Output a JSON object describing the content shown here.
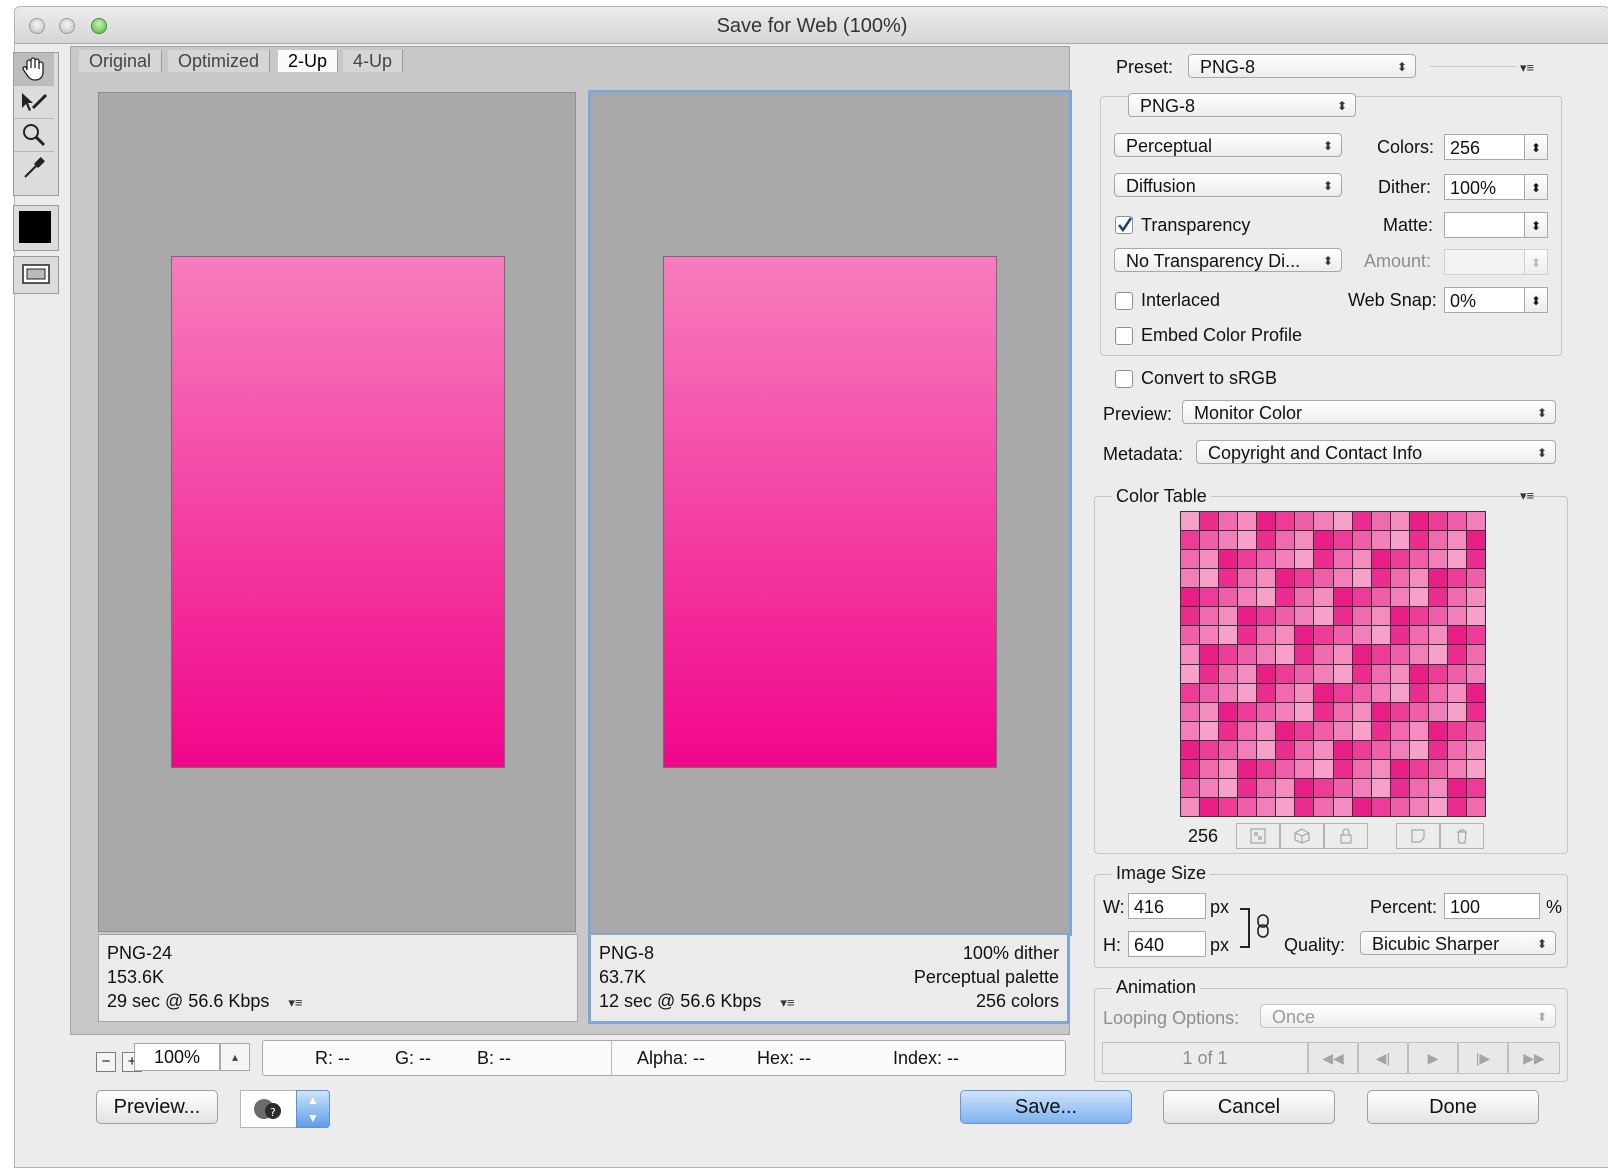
{
  "window": {
    "title": "Save for Web (100%)"
  },
  "tools": [
    "hand-tool",
    "slice-select-tool",
    "zoom-tool",
    "eyedropper-tool"
  ],
  "tabs": [
    {
      "label": "Original"
    },
    {
      "label": "Optimized"
    },
    {
      "label": "2-Up",
      "active": true
    },
    {
      "label": "4-Up"
    }
  ],
  "left_pane": {
    "format": "PNG-24",
    "size": "153.6K",
    "time": "29 sec @ 56.6 Kbps"
  },
  "right_pane": {
    "format": "PNG-8",
    "size": "63.7K",
    "time": "12 sec @ 56.6 Kbps",
    "dither": "100% dither",
    "palette": "Perceptual palette",
    "colors": "256 colors"
  },
  "statusbar": {
    "zoom": "100%",
    "r": "R: --",
    "g": "G: --",
    "b": "B: --",
    "alpha": "Alpha: --",
    "hex": "Hex: --",
    "index": "Index: --"
  },
  "buttons": {
    "preview": "Preview...",
    "save": "Save...",
    "cancel": "Cancel",
    "done": "Done"
  },
  "settings": {
    "preset_label": "Preset:",
    "preset_value": "PNG-8",
    "format_value": "PNG-8",
    "reduction": "Perceptual",
    "colors_label": "Colors:",
    "colors_value": "256",
    "dither_algo": "Diffusion",
    "dither_label": "Dither:",
    "dither_value": "100%",
    "transparency_label": "Transparency",
    "transparency_checked": true,
    "matte_label": "Matte:",
    "matte_value": "",
    "transparency_dither": "No Transparency Di...",
    "amount_label": "Amount:",
    "interlaced_label": "Interlaced",
    "websnap_label": "Web Snap:",
    "websnap_value": "0%",
    "embed_label": "Embed Color Profile",
    "convert_label": "Convert to sRGB",
    "preview_label": "Preview:",
    "preview_value": "Monitor Color",
    "metadata_label": "Metadata:",
    "metadata_value": "Copyright and Contact Info"
  },
  "color_table": {
    "title": "Color Table",
    "count": "256"
  },
  "image_size": {
    "title": "Image Size",
    "w_label": "W:",
    "w_value": "416",
    "unit": "px",
    "h_label": "H:",
    "h_value": "640",
    "percent_label": "Percent:",
    "percent_value": "100",
    "percent_unit": "%",
    "quality_label": "Quality:",
    "quality_value": "Bicubic Sharper"
  },
  "animation": {
    "title": "Animation",
    "looping_label": "Looping Options:",
    "looping_value": "Once",
    "frame": "1 of 1"
  },
  "colors": {
    "accent": "#7db3ee",
    "selection_border": "#7ea6d8",
    "image_top": "#f77dbd",
    "image_bottom": "#f1068a"
  }
}
